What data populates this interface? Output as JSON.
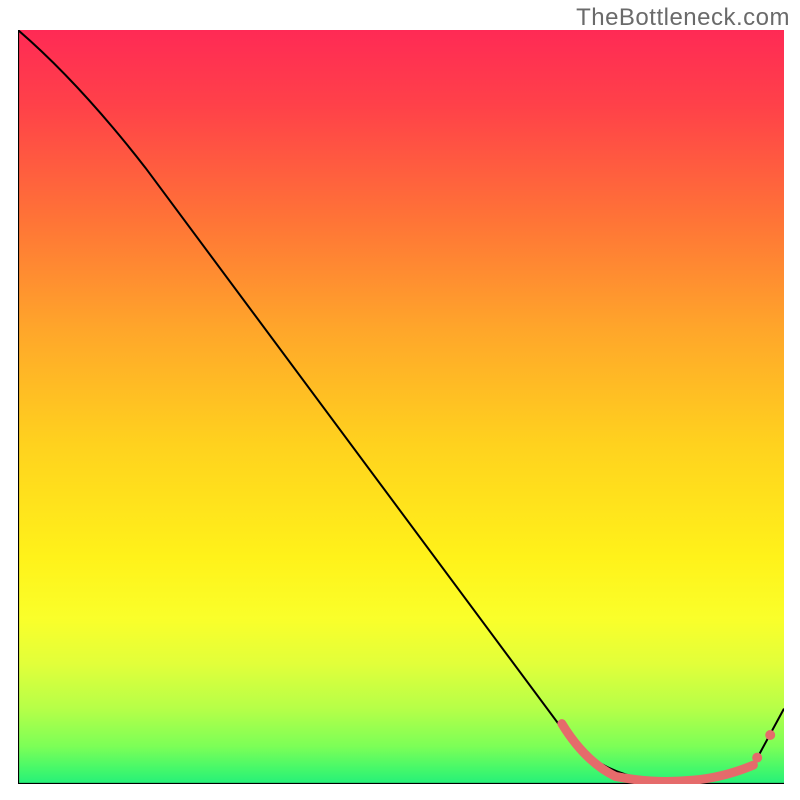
{
  "watermark": "TheBottleneck.com",
  "chart_data": {
    "type": "line",
    "title": "",
    "xlabel": "",
    "ylabel": "",
    "xlim": [
      0,
      100
    ],
    "ylim": [
      0,
      100
    ],
    "background_gradient": {
      "top": "#ff2a55",
      "mid": "#ffe83a",
      "bottom": "#25f07a"
    },
    "series": [
      {
        "name": "curve",
        "x": [
          0,
          8,
          72,
          80,
          88,
          96,
          100
        ],
        "y": [
          100,
          93,
          6,
          1,
          0.5,
          2.5,
          10
        ]
      }
    ],
    "highlight_range": {
      "name": "optimal-band",
      "x": [
        72,
        96
      ],
      "style": "coral"
    },
    "highlight_dots": {
      "x": [
        96.5,
        98.2
      ],
      "y": [
        3.5,
        6.5
      ]
    }
  }
}
